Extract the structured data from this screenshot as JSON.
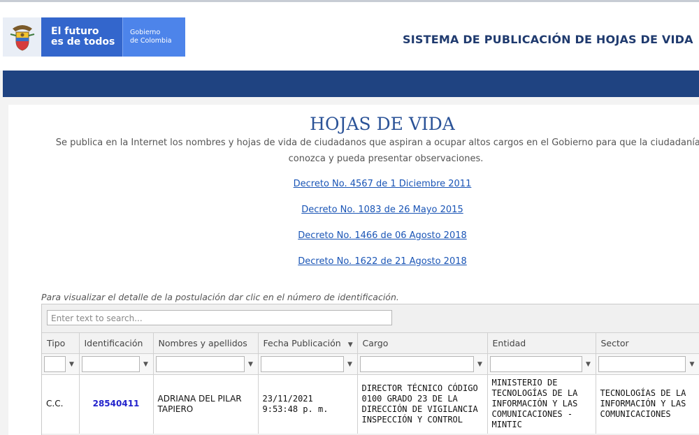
{
  "header": {
    "logo_line1": "El futuro",
    "logo_line2": "es de todos",
    "gov_line1": "Gobierno",
    "gov_line2": "de Colombia",
    "system_title": "SISTEMA DE PUBLICACIÓN DE HOJAS DE VIDA"
  },
  "main": {
    "title": "HOJAS DE VIDA",
    "intro_line1": "Se publica en la Internet los nombres y hojas de vida de ciudadanos que aspiran a ocupar altos cargos en el Gobierno para que la ciudadanía los",
    "intro_line2": "conozca y pueda presentar observaciones.",
    "decrees": [
      "Decreto No. 4567 de 1 Diciembre 2011",
      "Decreto No. 1083 de 26 Mayo 2015",
      "Decreto No. 1466 de 06 Agosto 2018",
      "Decreto No. 1622 de 21 Agosto 2018"
    ],
    "hint": "Para visualizar el detalle de la postulación dar clic en el número de identificación."
  },
  "grid": {
    "search_placeholder": "Enter text to search...",
    "columns": [
      "Tipo",
      "Identificación",
      "Nombres y apellidos",
      "Fecha Publicación",
      "Cargo",
      "Entidad",
      "Sector"
    ],
    "rows": [
      {
        "tipo": "C.C.",
        "identificacion": "28540411",
        "nombre": "ADRIANA DEL PILAR TAPIERO",
        "fecha": "23/11/2021 9:53:48 p. m.",
        "cargo": "DIRECTOR TÉCNICO CÓDIGO 0100 GRADO 23 DE LA DIRECCIÓN DE VIGILANCIA INSPECCIÓN Y CONTROL",
        "entidad": "MINISTERIO DE TECNOLOGÍAS DE LA INFORMACIÓN Y LAS COMUNICACIONES - MINTIC",
        "sector": "TECNOLOGÍAS DE LA INFORMACIÓN Y LAS COMUNICACIONES"
      }
    ]
  },
  "icons": {
    "filter": "filter-icon",
    "sort": "sort-desc-icon",
    "seal": "coat-of-arms-icon"
  },
  "colors": {
    "brand_blue": "#3366cc",
    "nav_bar": "#1f4381",
    "title_blue": "#2a5297",
    "link": "#1a55b6"
  }
}
